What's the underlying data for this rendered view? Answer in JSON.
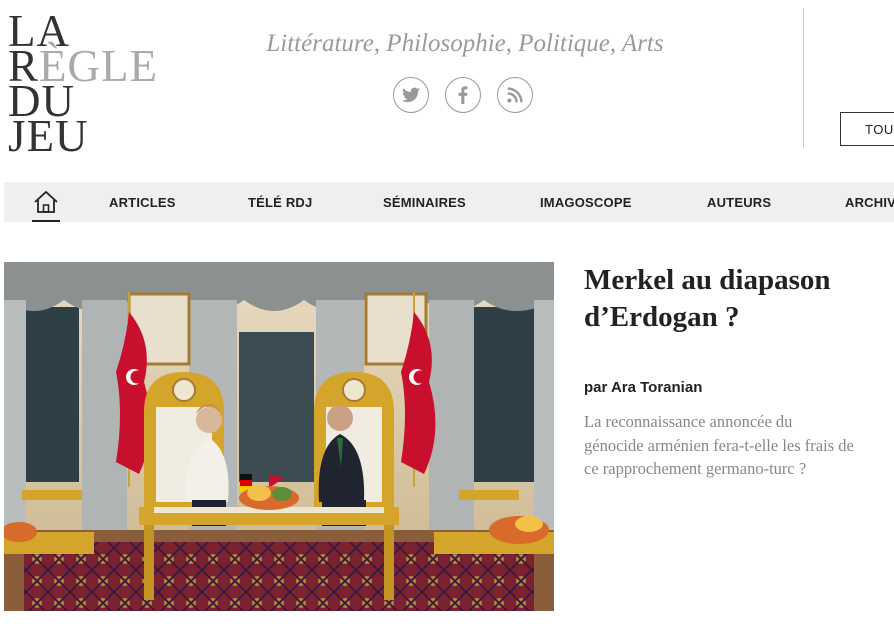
{
  "logo": {
    "line1": "LA",
    "line2a": "R",
    "line2b": "ÈGLE",
    "line3": "DU",
    "line4": "JEU"
  },
  "header": {
    "tagline": "Littérature, Philosophie, Politique, Arts",
    "tous_label": "TOUS"
  },
  "social": [
    "twitter-icon",
    "facebook-icon",
    "rss-icon"
  ],
  "nav": {
    "home_icon": "home-icon",
    "items": [
      "ARTICLES",
      "TÉLÉ RDJ",
      "SÉMINAIRES",
      "IMAGOSCOPE",
      "AUTEURS",
      "ARCHIV"
    ]
  },
  "article": {
    "title": "Merkel au diapason d’Erdogan ?",
    "author": "par Ara Toranian",
    "excerpt": "La reconnaissance annoncée du génocide arménien fera-t-elle les frais de ce rapprochement germano-turc ?"
  },
  "colors": {
    "nav_bg": "#efefef",
    "tagline": "#9a9a9a",
    "excerpt": "#888888",
    "flag_red": "#c8102e",
    "gold": "#d4a52a"
  }
}
